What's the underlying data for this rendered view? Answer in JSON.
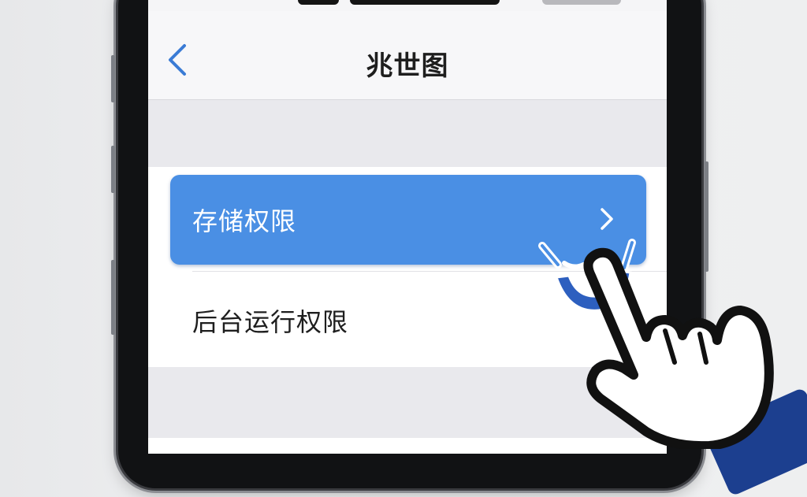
{
  "nav": {
    "title": "兆世图"
  },
  "permissions": {
    "items": [
      {
        "label": "存储权限",
        "highlighted": true
      },
      {
        "label": "后台运行权限",
        "highlighted": false
      }
    ]
  },
  "icons": {
    "back": "chevron-left-icon",
    "row_arrow": "chevron-right-icon",
    "pointer": "hand-pointer-icon"
  },
  "colors": {
    "accent_blue": "#4a8fe4",
    "back_chevron": "#3a7bd5",
    "screen_background": "#eeeef1"
  }
}
